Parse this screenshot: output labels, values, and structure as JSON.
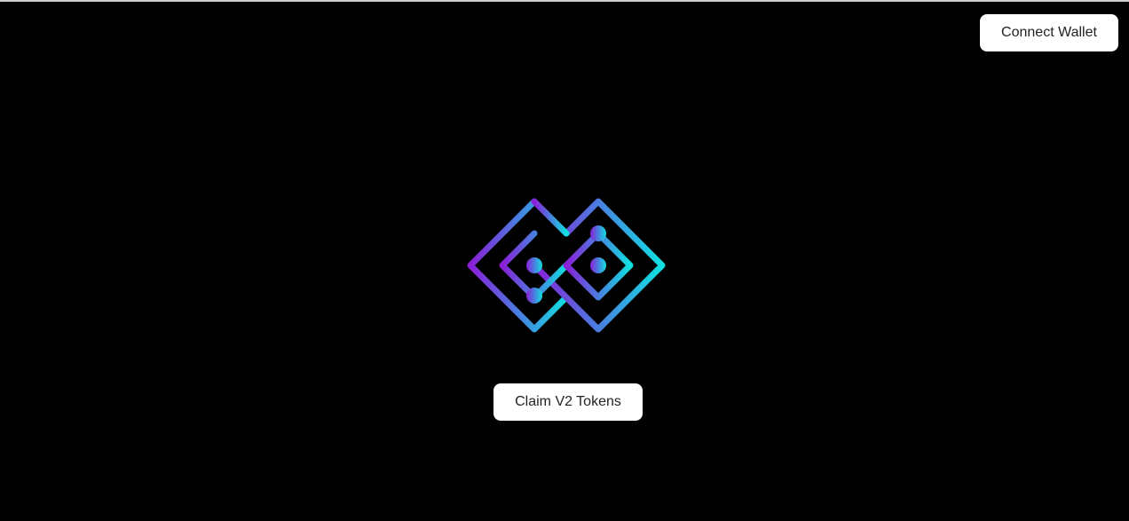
{
  "header": {
    "connect_wallet_label": "Connect Wallet"
  },
  "main": {
    "logo_icon": "circuit-infinity-logo-icon",
    "claim_label": "Claim V2 Tokens"
  },
  "colors": {
    "background": "#000000",
    "button_bg": "#ffffff",
    "button_text": "#222222",
    "logo_gradient_start": "#8a1fd6",
    "logo_gradient_mid": "#4a7ee0",
    "logo_gradient_end": "#10e0e0"
  }
}
